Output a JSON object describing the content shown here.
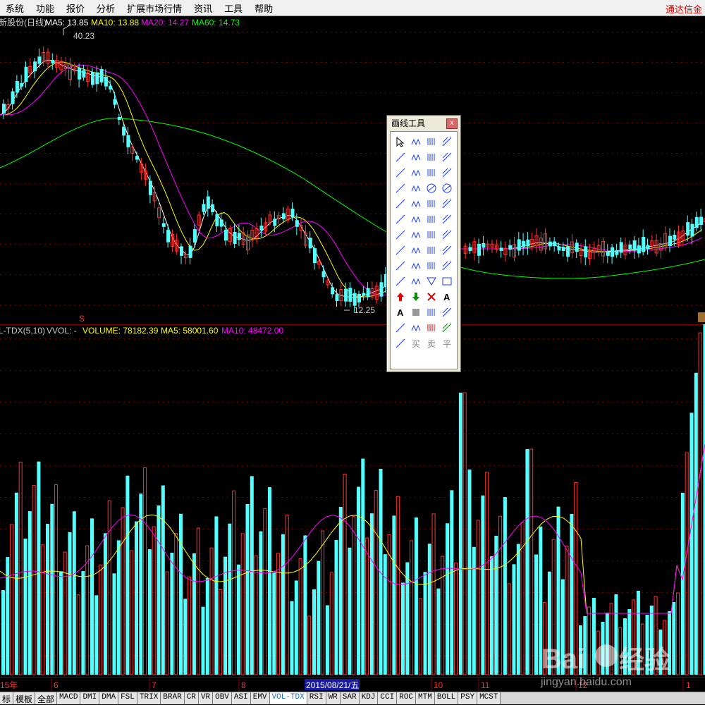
{
  "menu": {
    "items": [
      "系统",
      "功能",
      "报价",
      "分析",
      "扩展市场行情",
      "资讯",
      "工具",
      "帮助"
    ],
    "right_label": "通达信金"
  },
  "price_panel": {
    "title": "新股份(日线)",
    "ma5_label": "MA5: 13.85",
    "ma10_label": "MA10: 13.88",
    "ma20_label": "MA20: 14.27",
    "ma60_label": "MA60: 14.73",
    "high_marker": "40.23",
    "low_marker": "12.25",
    "colors": {
      "ma5": "#ffffff",
      "ma10": "#ffff00",
      "ma20": "#ff00ff",
      "ma60": "#00ff00",
      "up": "#ff3333",
      "down": "#54ffff"
    }
  },
  "volume_panel": {
    "indicator": "L-TDX(5,10)",
    "vvol_label": "VVOL: -",
    "volume_label": "VOLUME: 78182.39",
    "ma5_label": "MA5: 58001.60",
    "ma10_label": "MA10: 48472.00"
  },
  "timeline": {
    "labels": [
      "15年",
      "6",
      "7",
      "8",
      "10",
      "11",
      "12",
      "1"
    ],
    "cursor_date": "2015/08/21/五"
  },
  "tabs": [
    "标",
    "模板",
    "全部",
    "MACD",
    "DMI",
    "DMA",
    "FSL",
    "TRIX",
    "BRAR",
    "CR",
    "VR",
    "OBV",
    "ASI",
    "EMV",
    "VOL-TDX",
    "RSI",
    "WR",
    "SAR",
    "KDJ",
    "CCI",
    "ROC",
    "MTM",
    "BOLL",
    "PSY",
    "MCST"
  ],
  "active_tab": "VOL-TDX",
  "draw_toolbar": {
    "title": "画线工具",
    "close_label": "x",
    "trade_labels": [
      "买",
      "卖",
      "平"
    ],
    "text_tool": "A",
    "text_tool2": "A",
    "tool_icons": [
      "cursor",
      "segment",
      "line",
      "ray",
      "line-ext",
      "parallel",
      "channel",
      "fib",
      "vline",
      "label-123",
      "parallel-lines",
      "dual-lines",
      "wave-lines",
      "arc",
      "circle",
      "circle-cross",
      "wave-w",
      "zigzag",
      "zigzag-up",
      "zigzag-down",
      "polyline",
      "gp-label",
      "ga-label",
      "g-label",
      "price-channel",
      "regression",
      "gann-fan",
      "fan-lines",
      "vline-group",
      "cycle-lines",
      "period-lines",
      "percent-lines",
      "time-lines",
      "time-bars",
      "time-cycle",
      "speed-lines",
      "fan",
      "arrow-down",
      "triangle",
      "rectangle",
      "up-arrow",
      "down-arrow",
      "cross-x",
      "text-tool",
      "text-alt",
      "grey-block",
      "legend",
      "note",
      "ruler",
      "price-label",
      "buy-marker",
      "sell-marker",
      "flat-marker"
    ]
  },
  "watermark": {
    "line1": "Bai",
    "line2": "经验",
    "url": "jingyan.baidu.com"
  }
}
